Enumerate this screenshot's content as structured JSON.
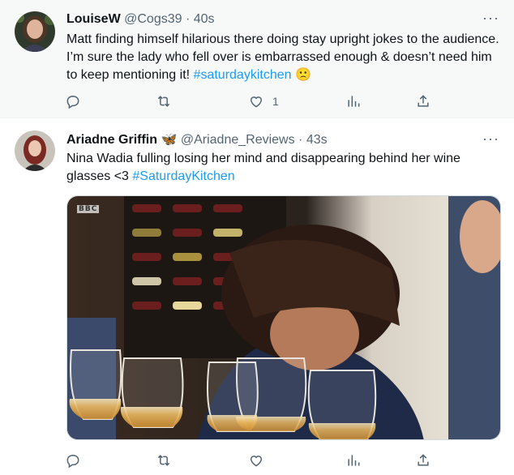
{
  "tweets": [
    {
      "name": "LouiseW",
      "handle": "@Cogs39",
      "separator": "·",
      "time": "40s",
      "more": "···",
      "text": "Matt finding himself hilarious there doing stay upright jokes to the audience. I’m sure the lady who fell over is embarrassed enough & doesn’t need him to keep mentioning it!",
      "hashtag": "#saturdaykitchen",
      "emoji": "🙁",
      "actions": {
        "reply": "",
        "retweet": "",
        "like": "1",
        "views": "",
        "share": ""
      }
    },
    {
      "name": "Ariadne Griffin",
      "badge_emoji": "🦋",
      "handle": "@Ariadne_Reviews",
      "separator": "·",
      "time": "43s",
      "more": "···",
      "text": "Nina Wadia fulling losing her mind and disappearing behind her wine glasses <3",
      "hashtag": "#SaturdayKitchen",
      "media": {
        "watermark": "BBC"
      },
      "actions": {
        "reply": "",
        "retweet": "",
        "like": "",
        "views": "",
        "share": ""
      }
    }
  ],
  "icons": [
    "reply-icon",
    "retweet-icon",
    "like-icon",
    "views-icon",
    "share-icon",
    "more-icon"
  ],
  "colors": {
    "link": "#1d9bf0",
    "muted": "#536471",
    "text": "#0f1419",
    "hover_bg": "#f7f9f9"
  }
}
